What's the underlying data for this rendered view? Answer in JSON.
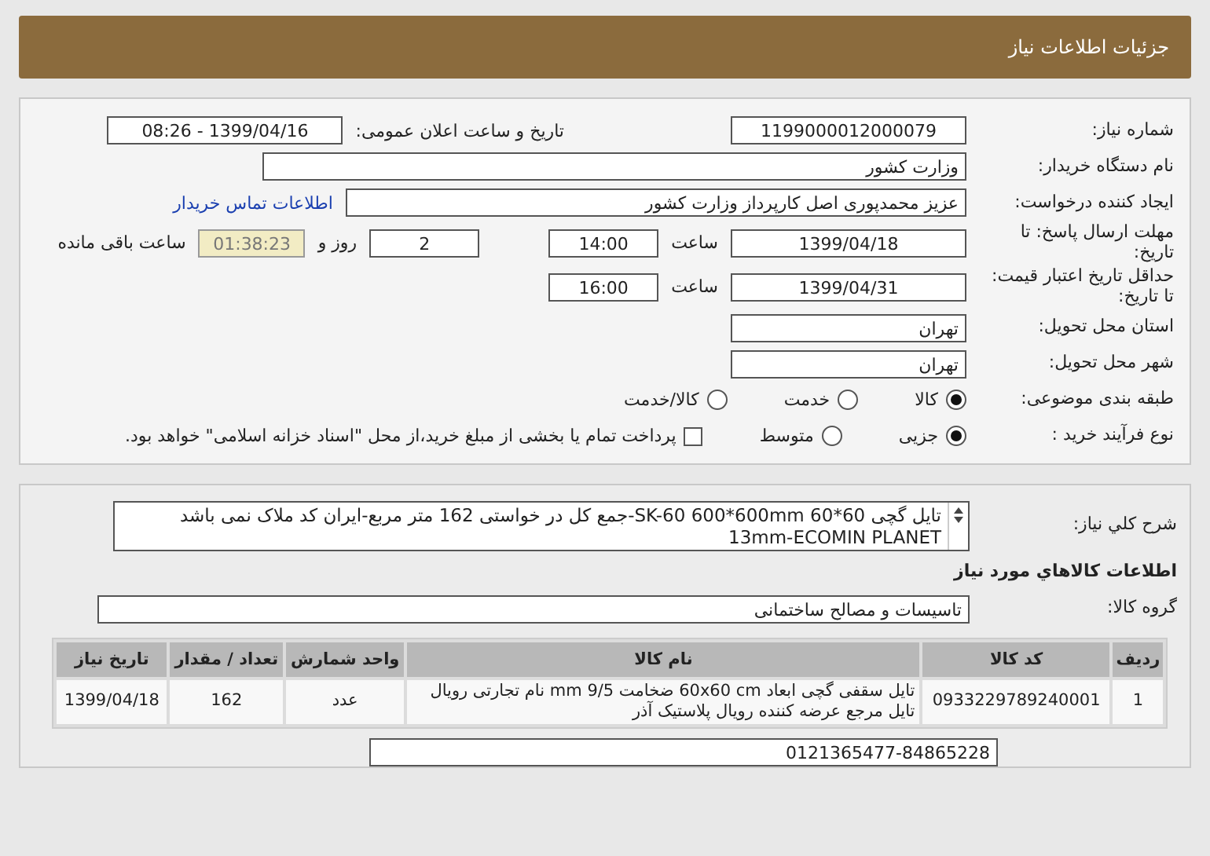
{
  "title": "جزئیات اطلاعات نیاز",
  "need_number": {
    "label": "شماره نیاز:",
    "value": "1199000012000079"
  },
  "announce": {
    "label": "تاریخ و ساعت اعلان عمومی:",
    "value": "1399/04/16 - 08:26"
  },
  "buyer": {
    "label": "نام دستگاه خریدار:",
    "value": "وزارت کشور"
  },
  "creator": {
    "label": "ایجاد کننده درخواست:",
    "value": "عزیز محمدپوری اصل کارپرداز وزارت کشور",
    "link": "اطلاعات تماس خریدار"
  },
  "deadline": {
    "label": "مهلت ارسال پاسخ: تا تاریخ:",
    "date": "1399/04/18",
    "time_label": "ساعت",
    "time": "14:00",
    "days": "2",
    "days_label": "روز و",
    "remaining": "01:38:23",
    "remaining_label": "ساعت باقی مانده"
  },
  "validity": {
    "label": "حداقل تاریخ اعتبار قیمت: تا تاریخ:",
    "date": "1399/04/31",
    "time_label": "ساعت",
    "time": "16:00"
  },
  "province": {
    "label": "استان محل تحویل:",
    "value": "تهران"
  },
  "city": {
    "label": "شهر محل تحویل:",
    "value": "تهران"
  },
  "category": {
    "label": "طبقه بندی موضوعی:",
    "options": [
      {
        "label": "کالا",
        "selected": true
      },
      {
        "label": "خدمت",
        "selected": false
      },
      {
        "label": "کالا/خدمت",
        "selected": false
      }
    ]
  },
  "process": {
    "label": "نوع فرآیند خرید :",
    "options": [
      {
        "label": "جزیی",
        "selected": true
      },
      {
        "label": "متوسط",
        "selected": false
      }
    ],
    "payment": {
      "checked": false,
      "label": "پرداخت تمام یا بخشی از مبلغ خرید،از محل \"اسناد خزانه اسلامی\" خواهد بود."
    }
  },
  "description": {
    "label": "شرح کلي نیاز:",
    "value": "تایل گچی 60*60 SK-60 600*600mm-جمع کل در خواستی 162 متر مربع-ایران کد ملاک نمی باشد 13mm-ECOMIN PLANET"
  },
  "items_heading": "اطلاعات کالاهاي مورد نیاز",
  "goods_group": {
    "label": "گروه کالا:",
    "value": "تاسیسات و مصالح ساختمانی"
  },
  "table": {
    "columns": [
      "ردیف",
      "کد کالا",
      "نام کالا",
      "واحد شمارش",
      "تعداد / مقدار",
      "تاریخ نیاز"
    ],
    "rows": [
      [
        "1",
        "0933229789240001",
        "تایل سقفی گچی ابعاد 60x60 cm ضخامت 9/5 mm نام تجارتی رویال تایل مرجع عرضه کننده رویال پلاستیک آذر",
        "عدد",
        "162",
        "1399/04/18"
      ]
    ]
  },
  "notes": {
    "value": "0121365477-84865228"
  }
}
